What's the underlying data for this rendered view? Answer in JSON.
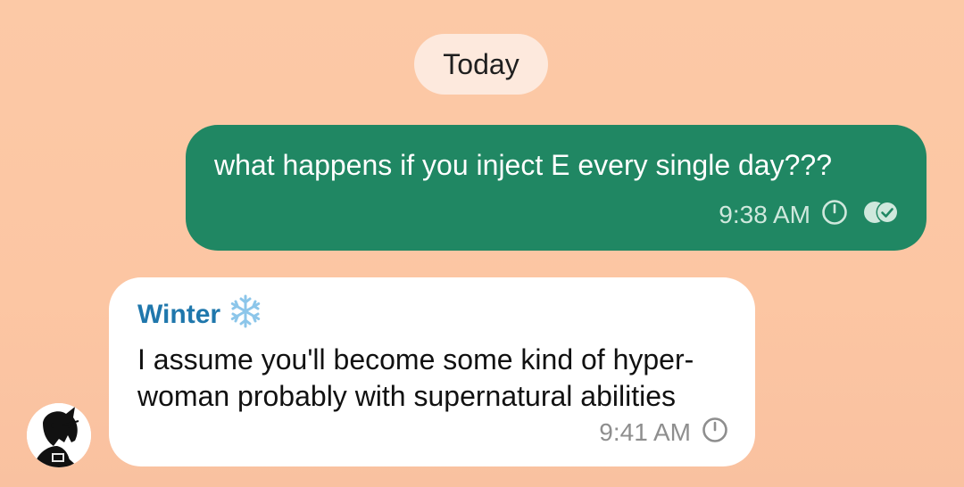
{
  "date_separator": {
    "label": "Today"
  },
  "messages": [
    {
      "direction": "outgoing",
      "text": "what happens if you inject E every single day???",
      "time": "9:38 AM",
      "status_icons": [
        "clock-icon",
        "read-receipt-icon"
      ]
    },
    {
      "direction": "incoming",
      "sender": "Winter",
      "sender_emoji": "❄️",
      "text": "I assume you'll become some kind of hyper-woman probably with supernatural abilities",
      "time": "9:41 AM",
      "status_icons": [
        "clock-icon"
      ]
    }
  ],
  "colors": {
    "background": "#fcc8a5",
    "outgoing_bubble": "#208763",
    "incoming_bubble": "#ffffff",
    "sender_name": "#1f77ac",
    "date_pill": "#fde9dd"
  }
}
